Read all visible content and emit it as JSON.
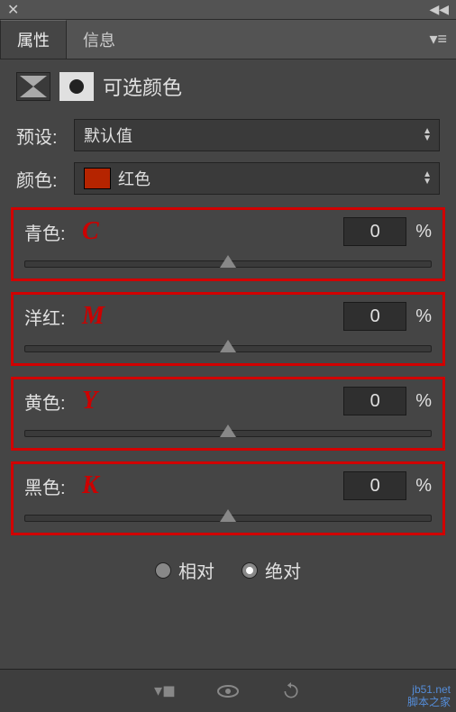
{
  "tabs": {
    "properties": "属性",
    "info": "信息"
  },
  "title": "可选颜色",
  "preset": {
    "label": "预设:",
    "value": "默认值"
  },
  "colors": {
    "label": "颜色:",
    "value": "红色",
    "swatch": "#b52400"
  },
  "sliders": {
    "cyan": {
      "label": "青色:",
      "letter": "C",
      "value": "0",
      "unit": "%"
    },
    "magenta": {
      "label": "洋红:",
      "letter": "M",
      "value": "0",
      "unit": "%"
    },
    "yellow": {
      "label": "黄色:",
      "letter": "Y",
      "value": "0",
      "unit": "%"
    },
    "black": {
      "label": "黑色:",
      "letter": "K",
      "value": "0",
      "unit": "%"
    }
  },
  "method": {
    "relative": "相对",
    "absolute": "绝对",
    "selected": "absolute"
  },
  "watermark": {
    "line1": "jb51.net",
    "line2": "脚本之家"
  }
}
